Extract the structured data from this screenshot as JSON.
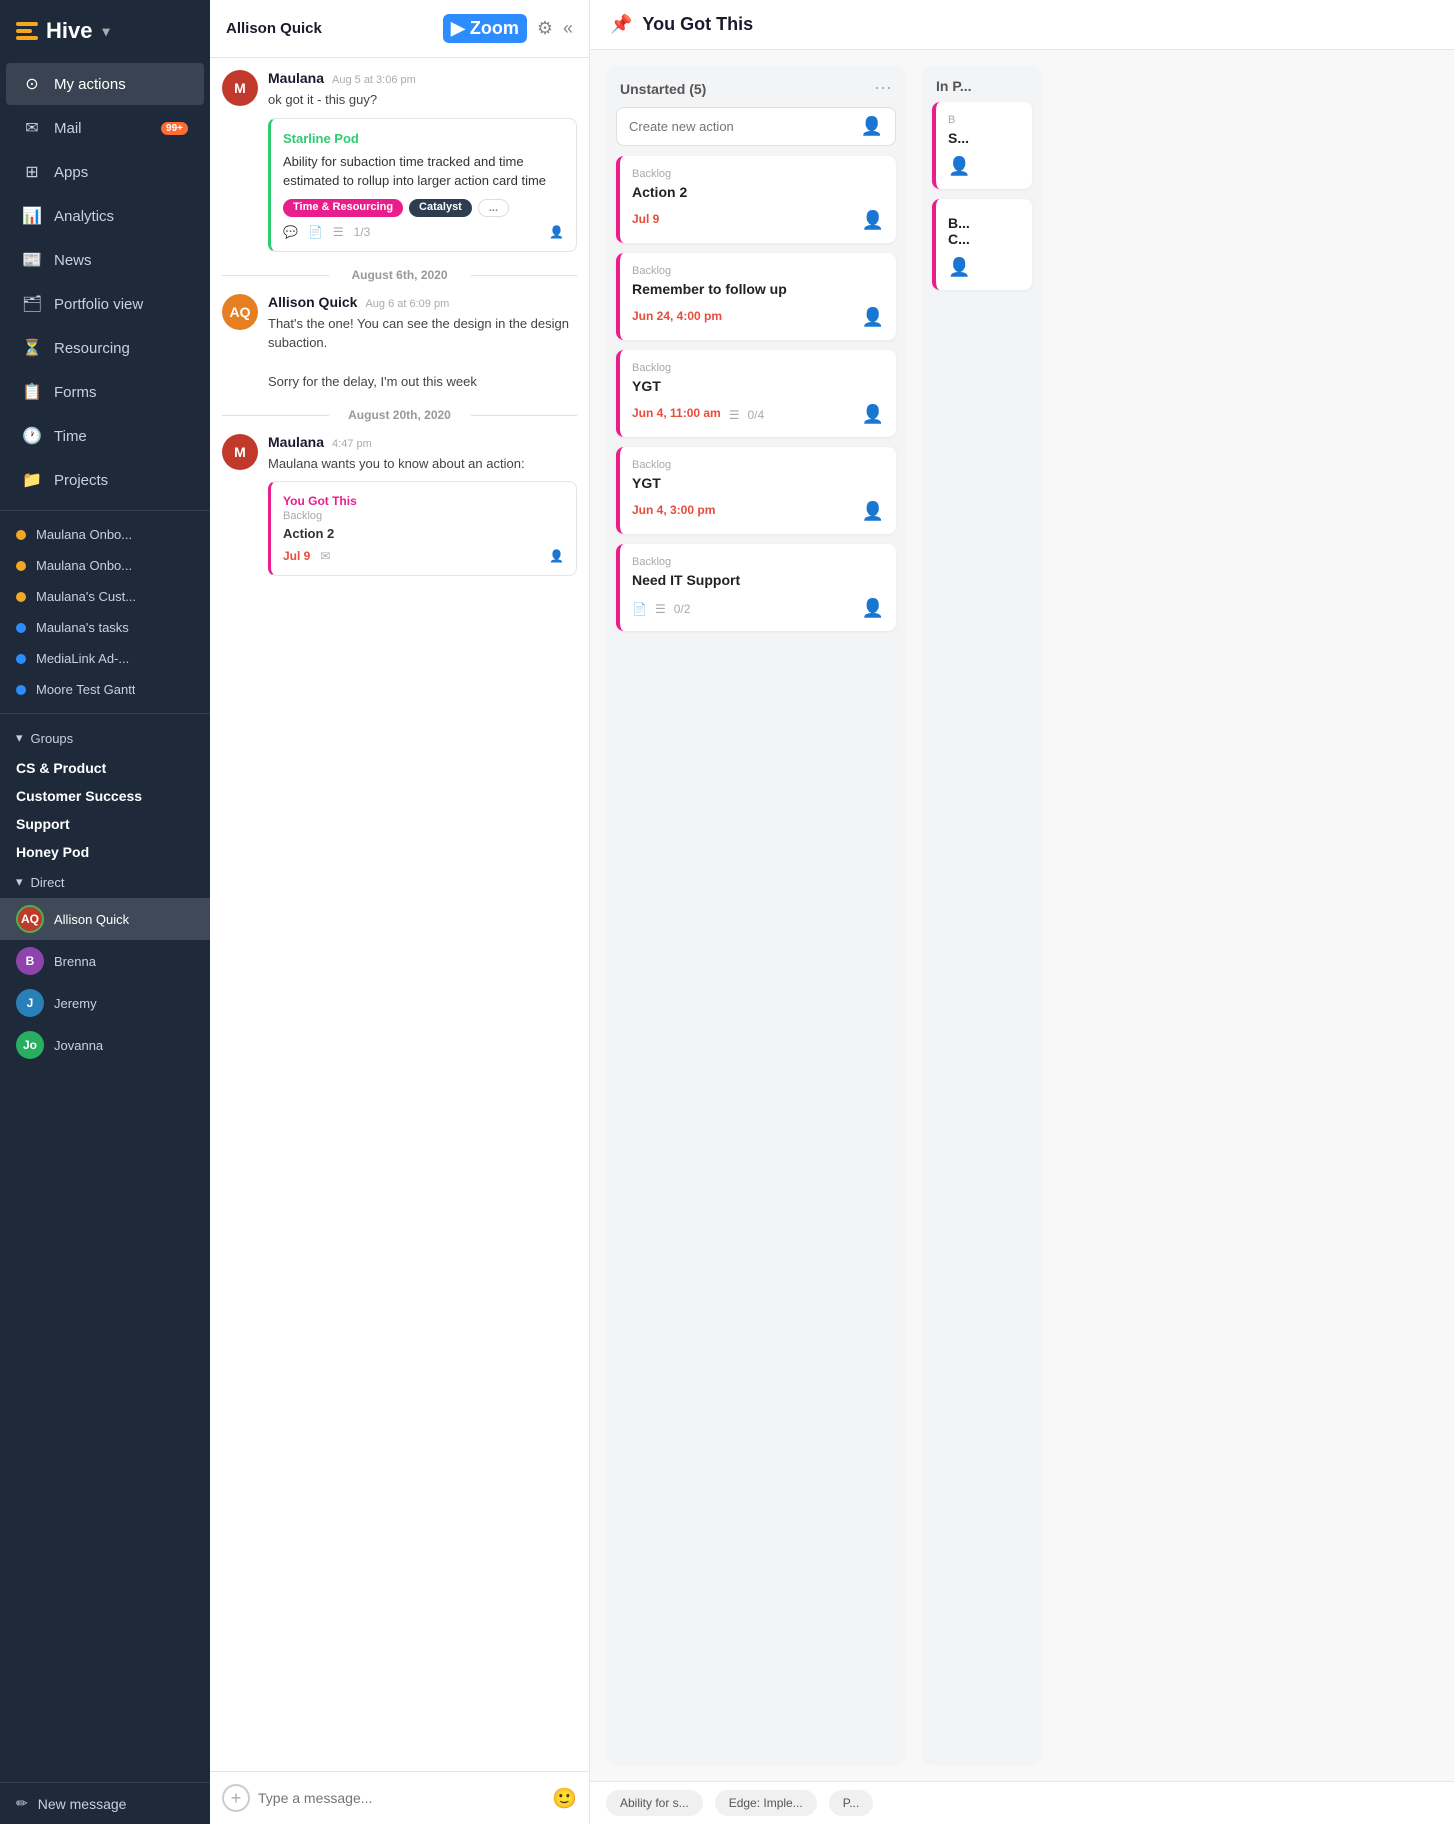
{
  "sidebar": {
    "logo": "Hive",
    "nav": [
      {
        "id": "my-actions",
        "label": "My actions",
        "icon": "⊙"
      },
      {
        "id": "mail",
        "label": "Mail",
        "icon": "✉",
        "badge": "99+"
      },
      {
        "id": "apps",
        "label": "Apps",
        "icon": "⊞"
      },
      {
        "id": "analytics",
        "label": "Analytics",
        "icon": "📊"
      },
      {
        "id": "news",
        "label": "News",
        "icon": "📰"
      },
      {
        "id": "portfolio-view",
        "label": "Portfolio view",
        "icon": "🗂"
      },
      {
        "id": "resourcing",
        "label": "Resourcing",
        "icon": "⏳"
      },
      {
        "id": "forms",
        "label": "Forms",
        "icon": "📋"
      },
      {
        "id": "time",
        "label": "Time",
        "icon": "🕐"
      },
      {
        "id": "projects",
        "label": "Projects",
        "icon": "📁"
      }
    ],
    "projects": [
      {
        "id": "maulana-onbo-1",
        "label": "Maulana Onbo...",
        "color": "#f5a623"
      },
      {
        "id": "maulana-onbo-2",
        "label": "Maulana Onbo...",
        "color": "#f5a623"
      },
      {
        "id": "maulanas-cust",
        "label": "Maulana's Cust...",
        "color": "#f5a623"
      },
      {
        "id": "maulanas-tasks",
        "label": "Maulana's tasks",
        "color": "#2d8cff"
      },
      {
        "id": "medialink-ad",
        "label": "MediaLink Ad-...",
        "color": "#2d8cff"
      },
      {
        "id": "moore-test-gantt",
        "label": "Moore Test Gantt",
        "color": "#2d8cff"
      }
    ],
    "groups_label": "Groups",
    "groups": [
      {
        "id": "cs-product",
        "label": "CS & Product"
      },
      {
        "id": "customer-success",
        "label": "Customer Success"
      },
      {
        "id": "support",
        "label": "Support"
      },
      {
        "id": "honey-pod",
        "label": "Honey Pod"
      }
    ],
    "direct_label": "Direct",
    "dms": [
      {
        "id": "allison-quick",
        "label": "Allison Quick",
        "color": "#c0392b",
        "initials": "AQ",
        "active": true
      },
      {
        "id": "brenna",
        "label": "Brenna",
        "color": "#8e44ad",
        "initials": "B"
      },
      {
        "id": "jeremy",
        "label": "Jeremy",
        "color": "#2980b9",
        "initials": "J"
      },
      {
        "id": "jovanna",
        "label": "Jovanna",
        "color": "#27ae60",
        "initials": "Jo"
      }
    ],
    "new_message": "New message"
  },
  "chat": {
    "header_name": "Allison Quick",
    "messages": [
      {
        "id": "msg1",
        "sender": "Maulana",
        "time": "Aug 5 at 3:06 pm",
        "text": "ok got it - this guy?",
        "has_action_card": true,
        "action_card": {
          "project": "Starline Pod",
          "project_color": "#2ecc71",
          "title": "Ability for subaction time tracked and time estimated to rollup into larger action card time",
          "tags": [
            "Time & Resourcing",
            "Catalyst",
            "..."
          ],
          "footer": {
            "comments": true,
            "notes": true,
            "subtasks": "1/3"
          }
        }
      },
      {
        "id": "msg2",
        "date_divider": "August 6th, 2020",
        "sender": "Allison Quick",
        "time": "Aug 6 at 6:09 pm",
        "text": "That's the one! You can see the design in the design subaction.\n\nSorry for the delay, I'm out this week"
      },
      {
        "id": "msg3",
        "date_divider": "August 20th, 2020",
        "sender": "Maulana",
        "time": "4:47 pm",
        "text": "Maulana wants you to know about an action:",
        "has_ref_card": true,
        "ref_card": {
          "project": "You Got This",
          "status": "Backlog",
          "title": "Action 2",
          "date": "Jul 9"
        }
      }
    ],
    "input_placeholder": "Type a message..."
  },
  "board": {
    "title": "You Got This",
    "columns": [
      {
        "id": "unstarted",
        "title": "Unstarted (5)",
        "create_placeholder": "Create new action",
        "cards": [
          {
            "id": "card1",
            "status": "Backlog",
            "title": "Action 2",
            "date": "Jul 9",
            "has_assign": true
          },
          {
            "id": "card2",
            "status": "Backlog",
            "title": "Remember to follow up",
            "date": "Jun 24, 4:00 pm",
            "has_assign": true
          },
          {
            "id": "card3",
            "status": "Backlog",
            "title": "YGT",
            "date": "Jun 4, 11:00 am",
            "subtasks": "0/4",
            "has_assign": true
          },
          {
            "id": "card4",
            "status": "Backlog",
            "title": "YGT",
            "date": "Jun 4, 3:00 pm",
            "has_assign": true
          },
          {
            "id": "card5",
            "status": "Backlog",
            "title": "Need IT Support",
            "has_notes": true,
            "subtasks": "0/2",
            "has_assign": true
          }
        ]
      },
      {
        "id": "in-progress",
        "title": "In P...",
        "cards": [
          {
            "id": "card6",
            "status": "B",
            "title": "S...",
            "has_assign": true
          },
          {
            "id": "card7",
            "status": "",
            "title": "B...\nC...",
            "has_assign": true
          }
        ]
      }
    ],
    "bottom_tabs": [
      "Ability for s...",
      "Edge: Imple...",
      "P..."
    ]
  }
}
